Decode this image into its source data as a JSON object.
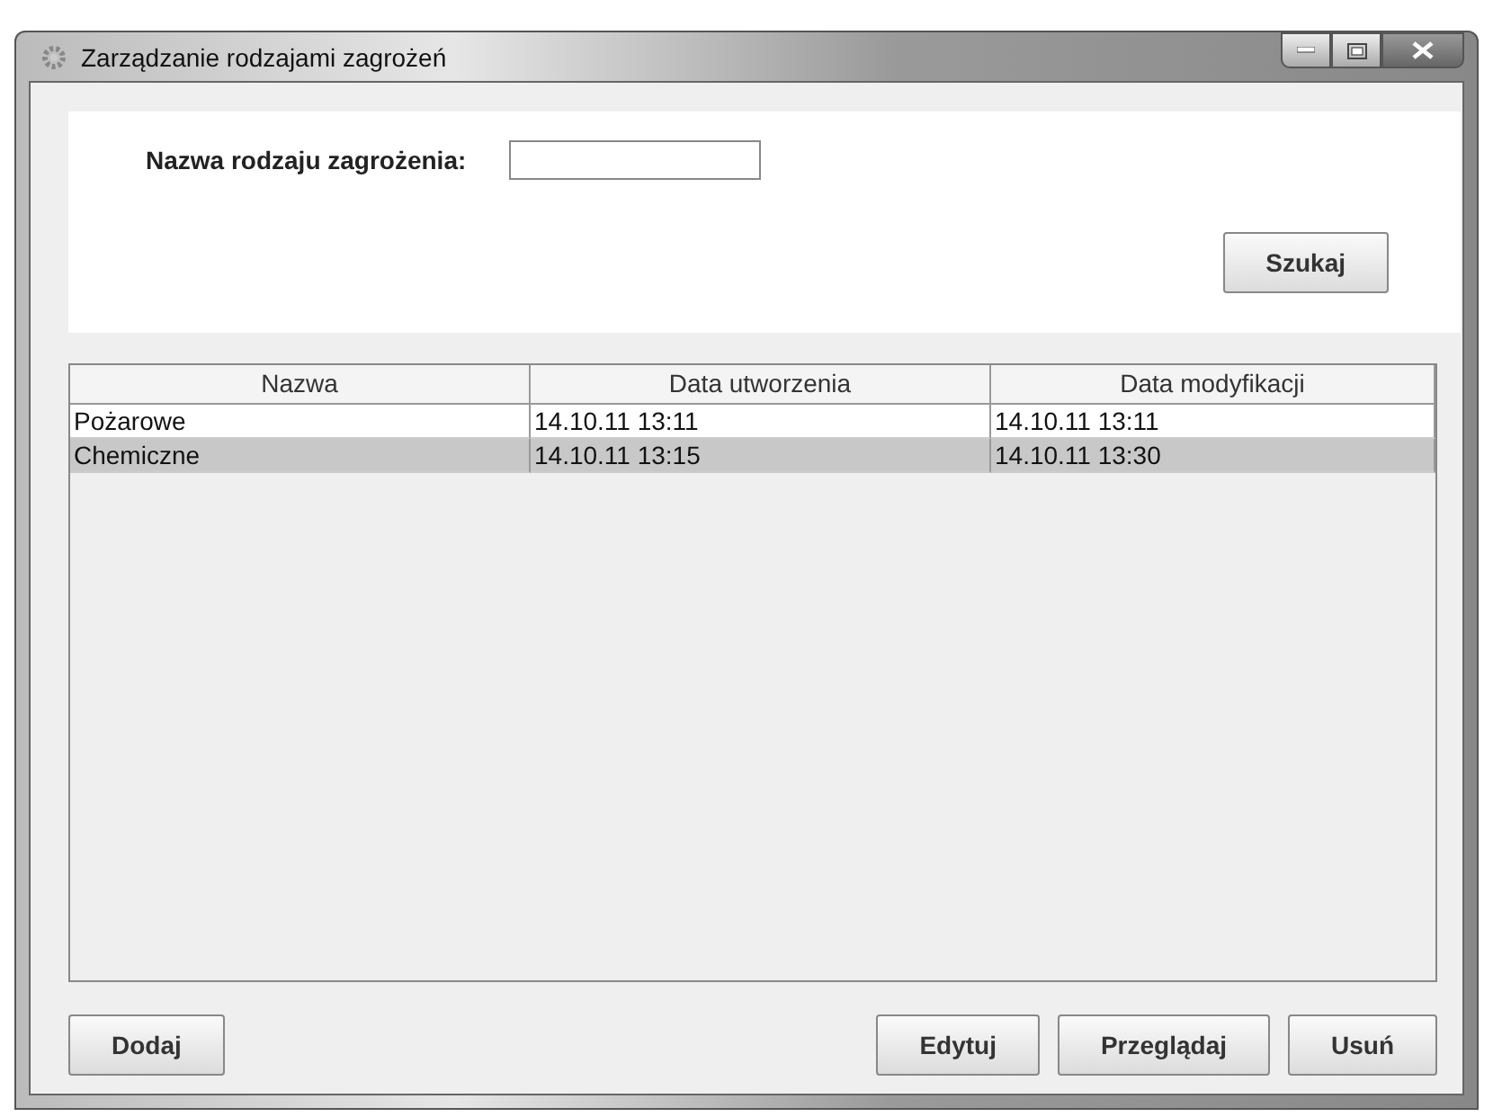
{
  "window": {
    "title": "Zarządzanie rodzajami zagrożeń"
  },
  "search": {
    "label": "Nazwa rodzaju zagrożenia:",
    "button": "Szukaj"
  },
  "table": {
    "columns": [
      "Nazwa",
      "Data utworzenia",
      "Data modyfikacji"
    ],
    "rows": [
      {
        "cells": [
          "Pożarowe",
          "14.10.11 13:11",
          "14.10.11 13:11"
        ],
        "selected": false
      },
      {
        "cells": [
          "Chemiczne",
          "14.10.11 13:15",
          "14.10.11 13:30"
        ],
        "selected": true
      }
    ]
  },
  "buttons_left": [
    "Dodaj"
  ],
  "buttons_right": [
    "Edytuj",
    "Przeglądaj",
    "Usuń"
  ]
}
